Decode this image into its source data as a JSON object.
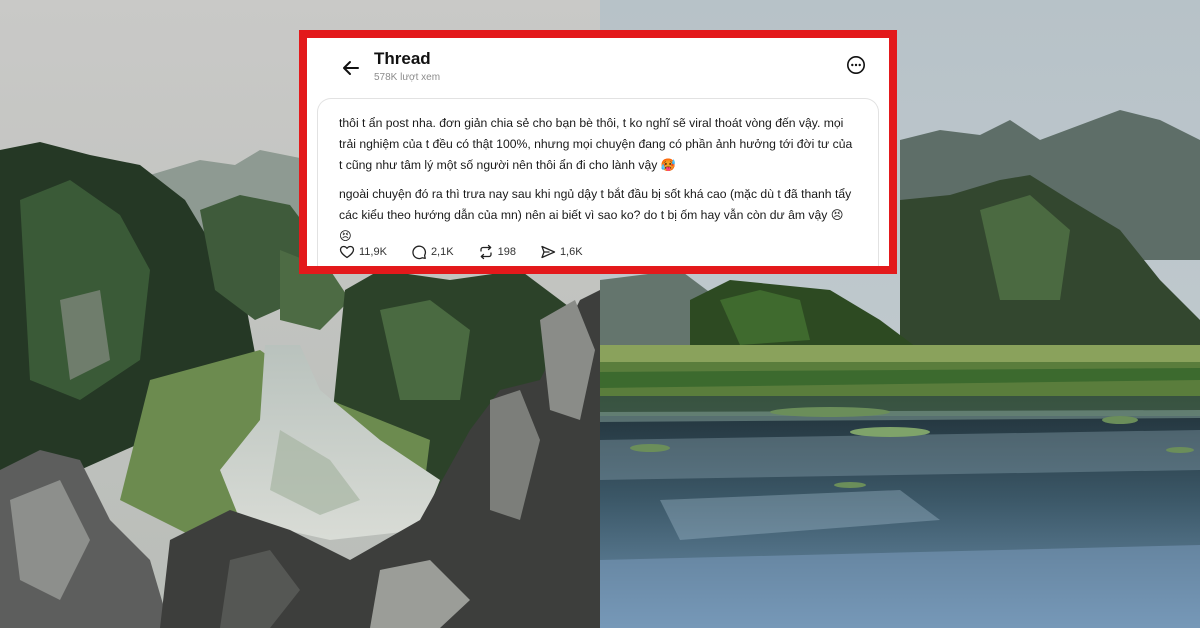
{
  "thread": {
    "title": "Thread",
    "views": "578K lượt xem",
    "paragraphs": [
      "thôi t ẩn post nha. đơn giản chia sẻ cho bạn bè thôi, t ko nghĩ sẽ viral thoát vòng đến vậy. mọi trải nghiệm của t đều có thật 100%, nhưng mọi chuyện đang có phần ảnh hưởng tới đời tư của t cũng như tâm lý một số người nên thôi ẩn đi cho lành vậy 🥵",
      "ngoài chuyện đó ra thì trưa nay sau khi ngủ dậy t bắt đầu bị sốt khá cao (mặc dù t đã thanh tẩy các kiểu theo hướng dẫn của mn) nên ai biết vì sao ko? do t bị ốm hay vẫn còn dư âm vậy 😣 😣"
    ],
    "stats": {
      "likes": "11,9K",
      "comments": "2,1K",
      "reposts": "198",
      "shares": "1,6K"
    }
  },
  "icons": {
    "back": "back-arrow-icon",
    "more": "more-options-icon",
    "like": "heart-icon",
    "comment": "comment-icon",
    "repost": "repost-icon",
    "share": "share-icon"
  },
  "colors": {
    "frame": "#e3191b",
    "card": "#ffffff"
  }
}
